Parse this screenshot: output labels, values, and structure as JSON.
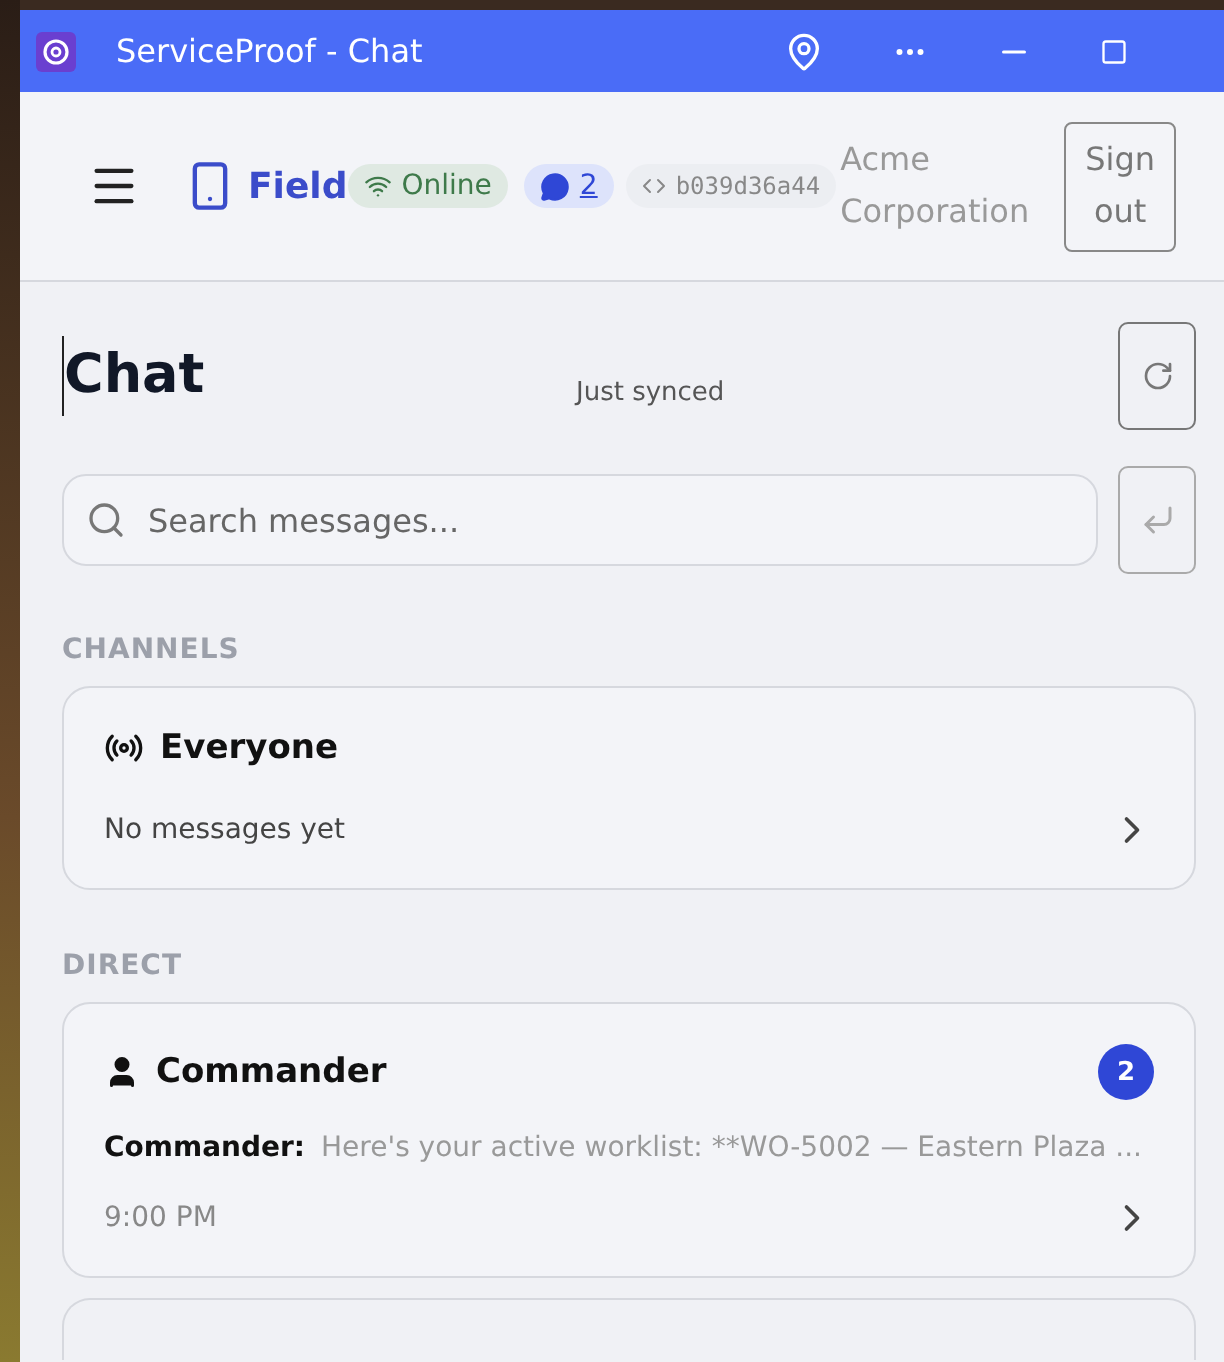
{
  "window": {
    "title": "ServiceProof - Chat"
  },
  "header": {
    "brand": "Field",
    "status": {
      "label": "Online",
      "online": true
    },
    "messages_badge": "2",
    "build": "b039d36a44",
    "organization": "Acme Corporation",
    "sign_out": "Sign out"
  },
  "page": {
    "title": "Chat",
    "sync_status": "Just synced"
  },
  "search": {
    "placeholder": "Search messages..."
  },
  "sections": [
    {
      "label": "CHANNELS",
      "items": [
        {
          "kind": "channel",
          "name": "Everyone",
          "preview": "No messages yet"
        }
      ]
    },
    {
      "label": "DIRECT",
      "items": [
        {
          "kind": "person",
          "name": "Commander",
          "sender": "Commander:",
          "preview": "Here's your active worklist: **WO-5002 — Eastern Plaza ...",
          "time": "9:00 PM",
          "unread": "2"
        }
      ]
    }
  ]
}
